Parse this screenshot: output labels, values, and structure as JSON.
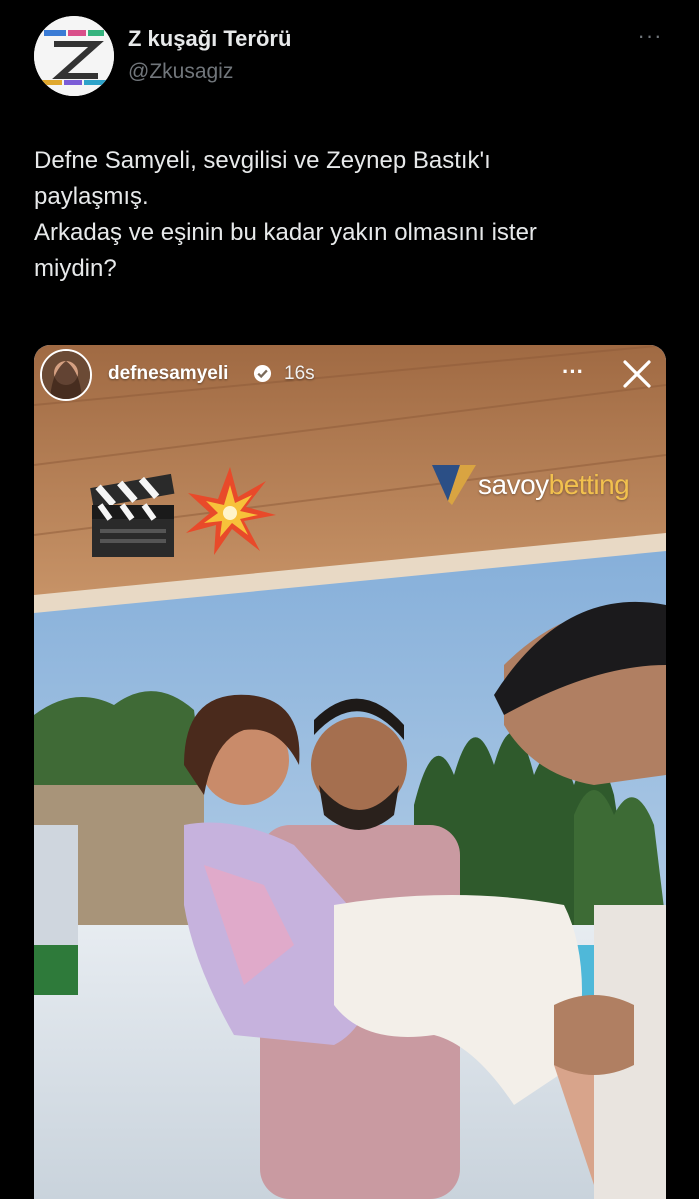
{
  "tweet": {
    "display_name": "Z kuşağı Terörü",
    "handle": "@Zkusagiz",
    "more_label": "···",
    "text": "Defne Samyeli, sevgilisi ve Zeynep Bastık'ı\npaylaşmış.\nArkadaş ve eşinin bu kadar yakın olmasını ister\nmiydin?"
  },
  "story": {
    "username": "defnesamyeli",
    "time": "16s",
    "more_label": "···",
    "brand_part1": "savoy",
    "brand_part2": "betting"
  },
  "colors": {
    "background": "#000000",
    "text_primary": "#e7e9ea",
    "text_secondary": "#71767b",
    "ceiling_wood": "#b9855d",
    "sky": "#8fb4d6",
    "brand_accent": "#f2c14e"
  },
  "icons": {
    "more": "more-horizontal-icon",
    "verified": "verified-badge-icon",
    "close": "close-icon",
    "clapper": "clapper-board-icon",
    "explosion": "collision-icon"
  }
}
